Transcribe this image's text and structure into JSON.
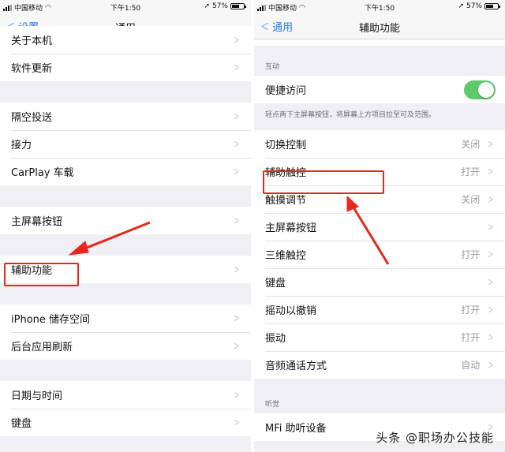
{
  "status_bar": {
    "carrier": "中国移动",
    "time": "下午1:50",
    "battery": "57%",
    "battery_level": 0.57
  },
  "left_screen": {
    "back_label": "设置",
    "title": "通用",
    "groups": [
      [
        {
          "label": "关于本机"
        },
        {
          "label": "软件更新"
        }
      ],
      [
        {
          "label": "隔空投送"
        },
        {
          "label": "接力"
        },
        {
          "label": "CarPlay 车载"
        }
      ],
      [
        {
          "label": "主屏幕按钮"
        }
      ],
      [
        {
          "label": "辅助功能"
        }
      ],
      [
        {
          "label": "iPhone 储存空间"
        },
        {
          "label": "后台应用刷新"
        }
      ],
      [
        {
          "label": "日期与时间"
        },
        {
          "label": "键盘"
        }
      ]
    ]
  },
  "right_screen": {
    "back_label": "通用",
    "title": "辅助功能",
    "section_interaction": "互动",
    "reachability": {
      "label": "便捷访问",
      "enabled": true
    },
    "reachability_footnote": "轻点两下主屏幕按钮，将屏幕上方项目拉至可及范围。",
    "items": [
      {
        "label": "切换控制",
        "value": "关闭"
      },
      {
        "label": "辅助触控",
        "value": "打开"
      },
      {
        "label": "触摸调节",
        "value": "关闭"
      },
      {
        "label": "主屏幕按钮",
        "value": ""
      },
      {
        "label": "三维触控",
        "value": "打开"
      },
      {
        "label": "键盘",
        "value": ""
      },
      {
        "label": "摇动以撤销",
        "value": "打开"
      },
      {
        "label": "振动",
        "value": "打开"
      },
      {
        "label": "音频通话方式",
        "value": "自动"
      }
    ],
    "section_hearing": "听觉",
    "hearing_items": [
      {
        "label": "MFi 助听设备"
      }
    ]
  },
  "watermark": "头条 @职场办公技能",
  "colors": {
    "accent": "#2a7cf6",
    "annotation": "#e8261c",
    "toggle_on": "#5fca6a"
  }
}
